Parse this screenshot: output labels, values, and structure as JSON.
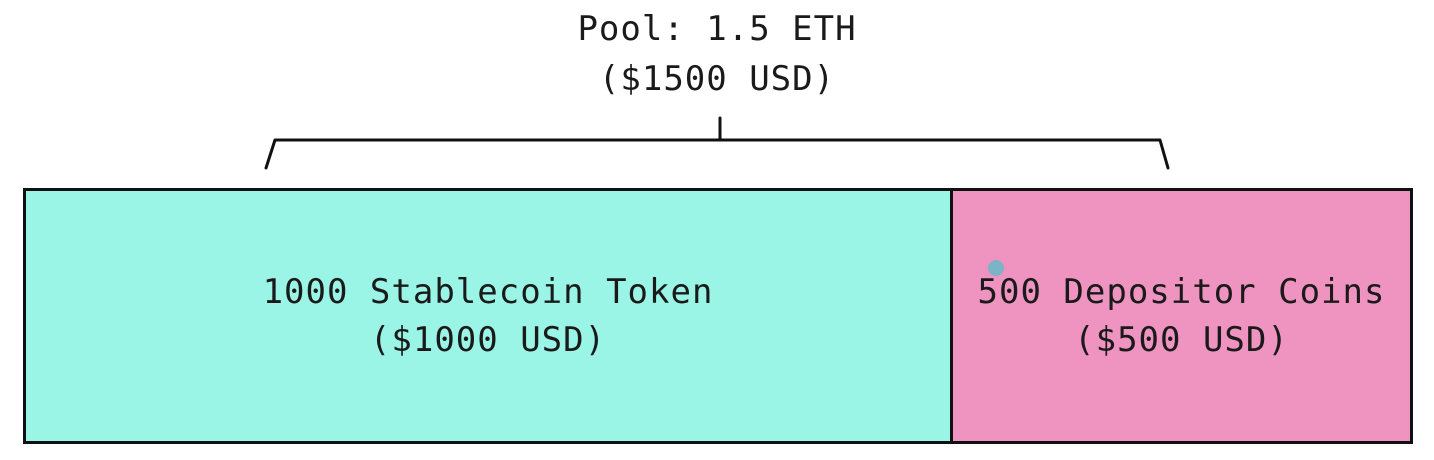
{
  "pool": {
    "line1": "Pool: 1.5 ETH",
    "line2": "($1500 USD)"
  },
  "segments": [
    {
      "line1": "1000 Stablecoin Token",
      "line2": "($1000 USD)",
      "color": "#9af5e6"
    },
    {
      "line1": "500 Depositor Coins",
      "line2": "($500 USD)",
      "color": "#ef93c1"
    }
  ],
  "icons": {
    "cursor": "dot-cursor-icon",
    "bracket": "curly-bracket-icon"
  }
}
